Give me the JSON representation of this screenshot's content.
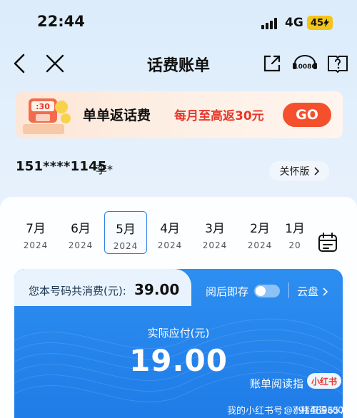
{
  "status_bar": {
    "time": "22:44",
    "network": "4G",
    "battery": "45"
  },
  "nav": {
    "title": "话费账单",
    "service_icon_label": "10086"
  },
  "promo": {
    "badge_text": ":30",
    "title": "单单返话费",
    "subtitle": "每月至高返30元",
    "button": "GO"
  },
  "account": {
    "phone": "151****1145",
    "name": "李*",
    "care_mode": "关怀版"
  },
  "months": [
    {
      "month": "7月",
      "year": "2024"
    },
    {
      "month": "6月",
      "year": "2024"
    },
    {
      "month": "5月",
      "year": "2024",
      "selected": true
    },
    {
      "month": "4月",
      "year": "2024"
    },
    {
      "month": "3月",
      "year": "2024"
    },
    {
      "month": "2月",
      "year": "2024"
    },
    {
      "month": "1月",
      "year": "20"
    }
  ],
  "bill": {
    "consumption_label": "您本号码共消费(元):",
    "consumption_value": "39.00",
    "read_delete": "阅后即存",
    "cloud": "云盘",
    "payable_label": "实际应付(元)",
    "payable_amount": "19.00",
    "reading_guide": "账单阅读指"
  },
  "watermark": {
    "badge": "小红书",
    "id_text": "我的小红书号：791469657",
    "corner": "@小猪蛋蛋300"
  },
  "colors": {
    "accent_blue": "#2d8ef0",
    "promo_red": "#e8362a",
    "go_button": "#f4502d",
    "battery": "#f3c419"
  }
}
